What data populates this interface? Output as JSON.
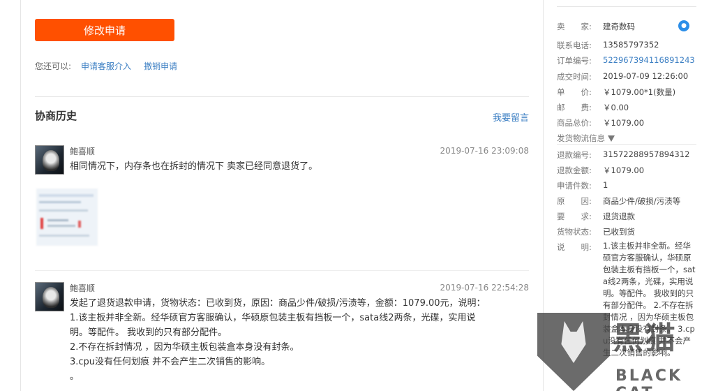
{
  "main": {
    "modify_button": "修改申请",
    "actions_label": "您还可以:",
    "action_links": [
      "申请客服介入",
      "撤销申请"
    ],
    "history_title": "协商历史",
    "leave_message": "我要留言",
    "messages": [
      {
        "user": "鲍喜顺",
        "time": "2019-07-16 23:09:08",
        "lines": [
          "相同情况下，内存条也在拆封的情况下   卖家已经同意退货了。"
        ]
      },
      {
        "user": "鲍喜顺",
        "time": "2019-07-16 22:54:28",
        "lines": [
          "发起了退货退款申请，货物状态：已收到货，原因：商品少件/破损/污渍等，金额：1079.00元，说明：",
          "1.该主板并非全新。经华硕官方客服确认，华硕原包装主板有挡板一个，sata线2两条，光碟，实用说",
          "明。等配件。  我收到的只有部分配件。",
          "2.不存在拆封情况  ，因为华硕主板包装盒本身没有封条。",
          "3.cpu没有任何划痕 并不会产生二次销售的影响。",
          "。"
        ]
      }
    ]
  },
  "sidebar": {
    "seller_label": "卖　　家:",
    "seller": "建奇数码",
    "phone_label": "联系电话:",
    "phone": "13585797352",
    "order_label": "订单编号:",
    "order": "522967394116891243",
    "deal_time_label": "成交时间:",
    "deal_time": "2019-07-09 12:26:00",
    "price_label": "单　　价:",
    "price": "￥1079.00*1(数量)",
    "postage_label": "邮　　费:",
    "postage": "￥0.00",
    "total_label": "商品总价:",
    "total": "￥1079.00",
    "logistics_label": "发货物流信息",
    "refund_no_label": "退款编号:",
    "refund_no": "31572288957894312",
    "refund_amount_label": "退款金额:",
    "refund_amount": "￥1079.00",
    "count_label": "申请件数:",
    "count": "1",
    "reason_label": "原　　因:",
    "reason": "商品少件/破损/污渍等",
    "request_label": "要　　求:",
    "request": "退货退款",
    "goods_status_label": "货物状态:",
    "goods_status": "已收到货",
    "desc_label": "说　　明:",
    "desc": "1.该主板并非全新。经华硕官方客服确认，华硕原包装主板有挡板一个，sata线2两条，光碟，实用说明。等配件。 我收到的只有部分配件。 2.不存在拆封情况 ，因为华硕主板包装盒本身没有封条。 3.cpu没有任何划痕 并不会产生二次销售的影响。"
  },
  "watermark": {
    "cn": "黑猫",
    "en": "BLACK CAT"
  },
  "colors": {
    "accent": "#ff5000",
    "link": "#3c7fc3"
  }
}
